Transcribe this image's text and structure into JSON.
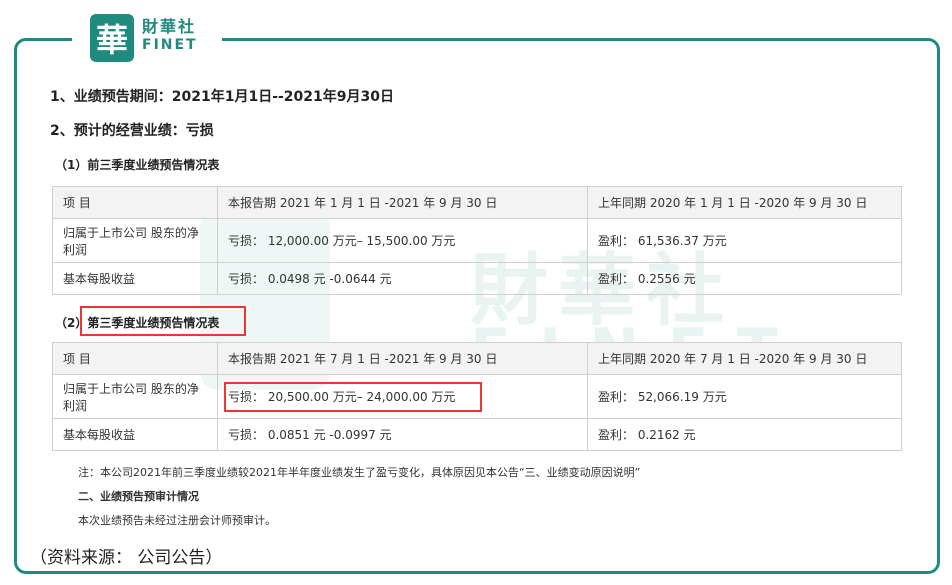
{
  "logo": {
    "glyph": "華",
    "cn": "財華社",
    "en": "FINET"
  },
  "watermark": {
    "cn": "財華社",
    "en": "FINET"
  },
  "heading1": "1、业绩预告期间：2021年1月1日--2021年9月30日",
  "heading2": "2、预计的经营业绩：亏损",
  "section1": {
    "title": "（1）前三季度业绩预告情况表",
    "rows": [
      [
        "项 目",
        "本报告期 2021 年 1 月 1 日 -2021 年 9 月 30 日",
        "上年同期 2020 年 1 月 1 日 -2020 年 9 月 30 日"
      ],
      [
        "归属于上市公司 股东的净利润",
        "亏损： 12,000.00 万元– 15,500.00 万元",
        "盈利： 61,536.37 万元"
      ],
      [
        "基本每股收益",
        "亏损： 0.0498 元 -0.0644 元",
        "盈利： 0.2556 元"
      ]
    ]
  },
  "section2": {
    "title": "（2）第三季度业绩预告情况表",
    "rows": [
      [
        "项 目",
        "本报告期 2021 年 7 月 1 日 -2021 年 9 月 30 日",
        "上年同期 2020 年 7 月 1 日 -2020 年 9 月 30 日"
      ],
      [
        "归属于上市公司 股东的净利润",
        "亏损： 20,500.00 万元– 24,000.00 万元",
        "盈利： 52,066.19 万元"
      ],
      [
        "基本每股收益",
        "亏损： 0.0851 元 -0.0997 元",
        "盈利： 0.2162 元"
      ]
    ]
  },
  "note": "注：本公司2021年前三季度业绩较2021年半年度业绩发生了盈亏变化，具体原因见本公告“三、业绩变动原因说明”",
  "audit_title": "二、业绩预告预审计情况",
  "audit_text": "本次业绩预告未经过注册会计师预审计。",
  "source": "（资料来源： 公司公告）",
  "colors": {
    "accent": "#1f8a7e",
    "highlight": "#e53935"
  }
}
